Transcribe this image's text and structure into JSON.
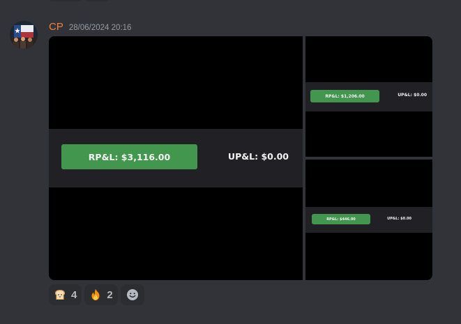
{
  "message": {
    "username": "CP",
    "timestamp": "28/06/2024 20:16",
    "username_color": "#f0813a",
    "avatar_icon": "texas-flag-group-avatar"
  },
  "attachments": [
    {
      "rp": "RP&L: $3,116.00",
      "up": "UP&L: $0.00"
    },
    {
      "rp": "RP&L: $1,206.00",
      "up": "UP&L: $0.00"
    },
    {
      "rp": "RP&L: $446.00",
      "up": "UP&L: $0.00"
    }
  ],
  "reactions": [
    {
      "emoji": "bread-emoji",
      "count": "4"
    },
    {
      "emoji": "fire-emoji",
      "count": "2"
    }
  ],
  "add_reaction_icon": "smiley-add-reaction-icon",
  "colors": {
    "background": "#313338",
    "rp_green": "#43964e",
    "band": "#212125"
  }
}
